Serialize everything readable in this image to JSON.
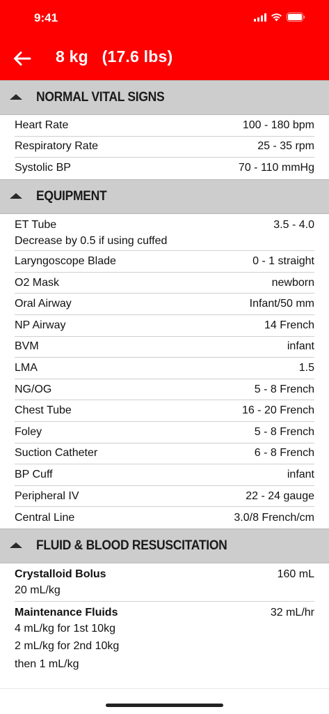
{
  "status_bar": {
    "time": "9:41"
  },
  "header": {
    "title": "8 kg   (17.6 lbs)"
  },
  "sections": {
    "vitals": {
      "title": "NORMAL VITAL SIGNS",
      "rows": [
        {
          "label": "Heart Rate",
          "value": "100 - 180 bpm"
        },
        {
          "label": "Respiratory Rate",
          "value": "25 - 35 rpm"
        },
        {
          "label": "Systolic BP",
          "value": "70 - 110 mmHg"
        }
      ]
    },
    "equipment": {
      "title": "EQUIPMENT",
      "et_tube": {
        "label": "ET Tube",
        "value": "3.5 - 4.0",
        "note": "Decrease by 0.5 if using cuffed"
      },
      "rows": [
        {
          "label": "Laryngoscope Blade",
          "value": "0 - 1 straight"
        },
        {
          "label": "O2 Mask",
          "value": "newborn"
        },
        {
          "label": "Oral Airway",
          "value": "Infant/50 mm"
        },
        {
          "label": "NP Airway",
          "value": "14 French"
        },
        {
          "label": "BVM",
          "value": "infant"
        },
        {
          "label": "LMA",
          "value": "1.5"
        },
        {
          "label": "NG/OG",
          "value": "5 - 8 French"
        },
        {
          "label": "Chest Tube",
          "value": "16 - 20 French"
        },
        {
          "label": "Foley",
          "value": "5 - 8 French"
        },
        {
          "label": "Suction Catheter",
          "value": "6 - 8 French"
        },
        {
          "label": "BP Cuff",
          "value": "infant"
        },
        {
          "label": "Peripheral IV",
          "value": "22 - 24 gauge"
        },
        {
          "label": "Central Line",
          "value": "3.0/8 French/cm"
        }
      ]
    },
    "fluids": {
      "title": "FLUID & BLOOD RESUSCITATION",
      "crystalloid": {
        "label": "Crystalloid Bolus",
        "value": "160 mL",
        "note": "20 mL/kg"
      },
      "maintenance": {
        "label": "Maintenance Fluids",
        "value": "32 mL/hr",
        "notes": [
          "4 mL/kg for 1st 10kg",
          "2 mL/kg for 2nd 10kg",
          "then 1 mL/kg"
        ]
      }
    }
  }
}
